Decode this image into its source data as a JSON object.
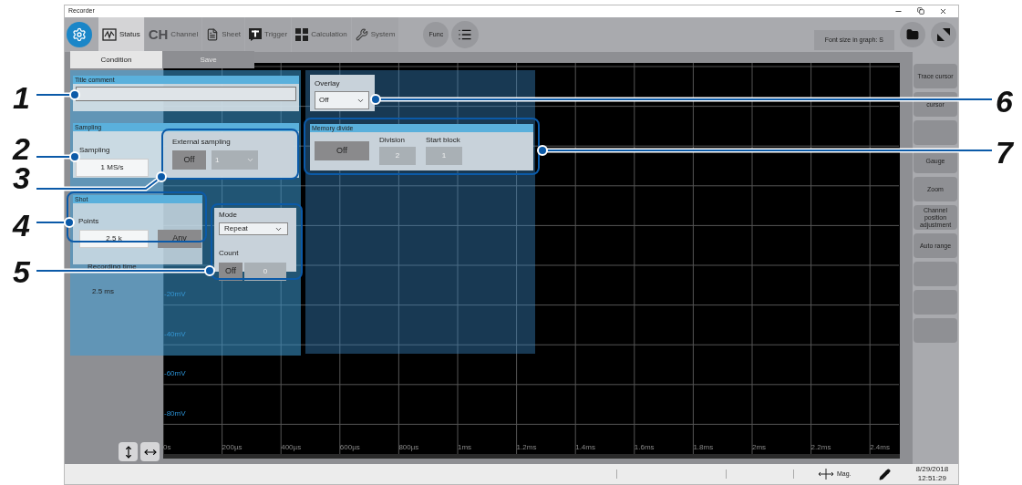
{
  "window": {
    "title": "Recorder"
  },
  "tabs": [
    {
      "label": "Status",
      "kind": "status",
      "selected": true
    },
    {
      "label": "Channel",
      "kind": "channel",
      "badge": "CH",
      "selected": false
    },
    {
      "label": "Sheet",
      "kind": "sheet",
      "selected": false
    },
    {
      "label": "Trigger",
      "kind": "trigger",
      "selected": false
    },
    {
      "label": "Calculation",
      "kind": "calculation",
      "selected": false
    },
    {
      "label": "System",
      "kind": "system",
      "selected": false
    }
  ],
  "func_button": "Func",
  "font_size_button": "Font size in graph: S",
  "subtabs": [
    {
      "label": "Condition",
      "selected": true
    },
    {
      "label": "Save",
      "selected": false
    }
  ],
  "side_buttons": [
    {
      "kind": "labeled",
      "label": "Trace cursor"
    },
    {
      "kind": "labeled",
      "label": "cursor"
    },
    {
      "kind": "blank"
    },
    {
      "kind": "labeled",
      "label": "Gauge"
    },
    {
      "kind": "labeled",
      "label": "Zoom"
    },
    {
      "kind": "labeled",
      "label": "Channel position adjustment"
    },
    {
      "kind": "labeled",
      "label": "Auto range"
    },
    {
      "kind": "blank"
    },
    {
      "kind": "blank"
    },
    {
      "kind": "blank"
    }
  ],
  "graph": {
    "y_labels": [
      "-20mV",
      "-40mV",
      "-60mV",
      "-80mV"
    ],
    "x_labels": [
      "0s",
      "200µs",
      "400µs",
      "600µs",
      "800µs",
      "1ms",
      "1.2ms",
      "1.4ms",
      "1.6ms",
      "1.8ms",
      "2ms",
      "2.2ms",
      "2.4ms"
    ]
  },
  "title_comment": {
    "header": "Title comment"
  },
  "sampling": {
    "header": "Sampling",
    "label": "Sampling",
    "value": "1 MS/s",
    "external": {
      "label": "External sampling",
      "toggle": "Off",
      "value": "1",
      "disabled": true
    }
  },
  "shot": {
    "header": "Shot",
    "points_label": "Points",
    "points_value": "2.5 k",
    "any_button": "Any",
    "recording_time_label": "Recording time",
    "recording_time_value": "2.5 ms",
    "mode_label": "Mode",
    "mode_value": "Repeat",
    "count_label": "Count",
    "count_toggle": "Off",
    "count_value": "0"
  },
  "overlay": {
    "label": "Overlay",
    "value": "Off"
  },
  "memory_divide": {
    "header": "Memory divide",
    "toggle": "Off",
    "division_label": "Division",
    "division_value": "2",
    "start_block_label": "Start block",
    "start_block_value": "1"
  },
  "status_bar": {
    "mag_label": "Mag.",
    "date": "8/29/2018",
    "time": "12:51:29"
  },
  "callouts": [
    "1",
    "2",
    "3",
    "4",
    "5",
    "6",
    "7"
  ]
}
